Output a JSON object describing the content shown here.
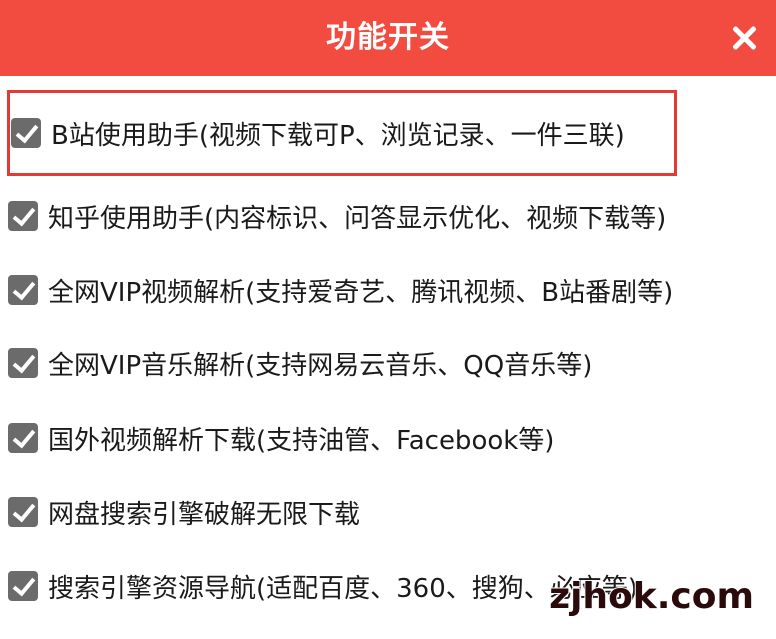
{
  "dialog": {
    "title": "功能开关",
    "close_icon": "close-icon"
  },
  "options": [
    {
      "label": "B站使用助手(视频下载可P、浏览记录、一件三联)",
      "checked": true
    },
    {
      "label": "知乎使用助手(内容标识、问答显示优化、视频下载等)",
      "checked": true
    },
    {
      "label": "全网VIP视频解析(支持爱奇艺、腾讯视频、B站番剧等)",
      "checked": true
    },
    {
      "label": "全网VIP音乐解析(支持网易云音乐、QQ音乐等)",
      "checked": true
    },
    {
      "label": "国外视频解析下载(支持油管、Facebook等)",
      "checked": true
    },
    {
      "label": "网盘搜索引擎破解无限下载",
      "checked": true
    },
    {
      "label": "搜索引擎资源导航(适配百度、360、搜狗、必应等)",
      "checked": true
    }
  ],
  "watermark": "zjhok.com",
  "colors": {
    "header": "#f24b40",
    "highlight_border": "#e53935",
    "checkbox": "#6b6b6b"
  }
}
